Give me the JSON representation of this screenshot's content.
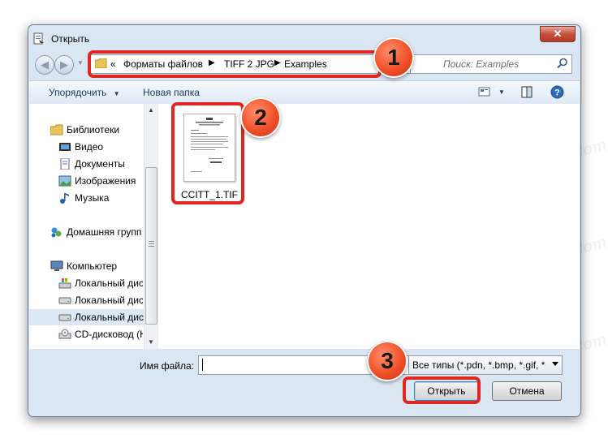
{
  "window": {
    "title": "Открыть",
    "close_label": "✕"
  },
  "address": {
    "overflow": "«",
    "parts": [
      "Форматы файлов",
      "TIFF 2 JPG",
      "Examples"
    ]
  },
  "search": {
    "placeholder": "Поиск: Examples"
  },
  "toolbar": {
    "organize": "Упорядочить",
    "new_folder": "Новая папка"
  },
  "sidebar": {
    "items": [
      {
        "label": "Библиотеки",
        "icon": "libraries-icon"
      },
      {
        "label": "Видео",
        "icon": "video-icon"
      },
      {
        "label": "Документы",
        "icon": "documents-icon"
      },
      {
        "label": "Изображения",
        "icon": "pictures-icon"
      },
      {
        "label": "Музыка",
        "icon": "music-icon"
      },
      {
        "label": "Домашняя групп",
        "icon": "homegroup-icon"
      },
      {
        "label": "Компьютер",
        "icon": "computer-icon"
      },
      {
        "label": "Локальный дис",
        "icon": "system-drive-icon"
      },
      {
        "label": "Локальный дис",
        "icon": "drive-icon"
      },
      {
        "label": "Локальный дис",
        "icon": "drive-icon",
        "selected": true
      },
      {
        "label": "CD-дисковод (Н",
        "icon": "cd-drive-icon"
      }
    ]
  },
  "files": [
    {
      "name": "CCITT_1.TIF"
    }
  ],
  "bottom": {
    "filename_label": "Имя файла:",
    "filename_value": "",
    "filetype": "Все типы (*.pdn, *.bmp, *.gif, *",
    "open_label": "Открыть",
    "cancel_label": "Отмена"
  },
  "annotations": {
    "badge1": "1",
    "badge2": "2",
    "badge3": "3",
    "color": "#e0261f"
  },
  "watermark": "Soringpcrepair.com"
}
